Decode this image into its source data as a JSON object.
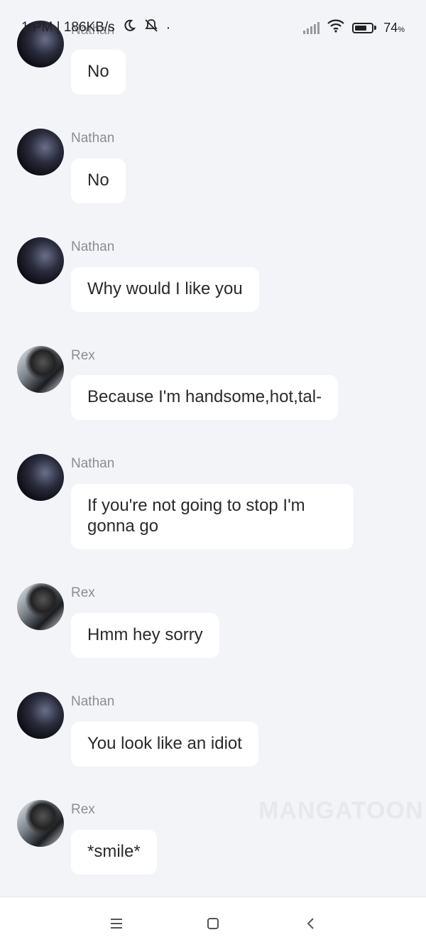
{
  "status_bar": {
    "time": "1:PM | 186KB/s",
    "dot": "·",
    "battery_percent": "74",
    "battery_unit": "%",
    "battery_level": 0.74,
    "icons": [
      "moon-icon",
      "silent-bell-icon",
      "signal-icon",
      "wifi-icon",
      "battery-icon"
    ]
  },
  "messages": [
    {
      "sender": "Nathan",
      "text": "No"
    },
    {
      "sender": "Nathan",
      "text": "No"
    },
    {
      "sender": "Nathan",
      "text": "Why would I like you"
    },
    {
      "sender": "Rex",
      "text": "Because I'm handsome,hot,tal-"
    },
    {
      "sender": "Nathan",
      "text": "If you're not going to stop I'm gonna go"
    },
    {
      "sender": "Rex",
      "text": "Hmm hey sorry"
    },
    {
      "sender": "Nathan",
      "text": "You look like an idiot"
    },
    {
      "sender": "Rex",
      "text": "*smile*"
    }
  ],
  "watermark": "MANGATOON",
  "nav_bar": {
    "icons": [
      "menu-icon",
      "home-square-icon",
      "back-chevron-icon"
    ]
  }
}
